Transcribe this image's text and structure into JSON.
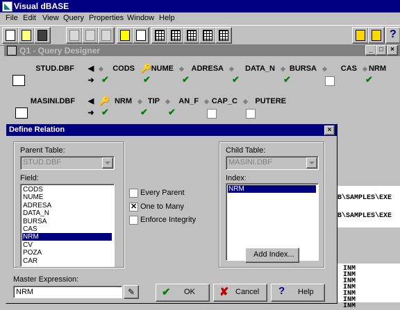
{
  "app": {
    "title": "Visual dBASE"
  },
  "menu": [
    "File",
    "Edit",
    "View",
    "Query",
    "Properties",
    "Window",
    "Help"
  ],
  "toolbar": {
    "buttons": [
      "new-icon",
      "open-icon",
      "save-icon",
      "cut-icon",
      "copy-icon",
      "paste-icon",
      "run-icon",
      "design-icon",
      "form-icon",
      "table-icon",
      "add-table-icon",
      "relation-icon",
      "expert-icon",
      "lamp-icon",
      "help-icon"
    ]
  },
  "query_designer": {
    "title": "Q1 - Query Designer",
    "tables": [
      {
        "name": "STUD.DBF",
        "fields": [
          "CODS",
          "NUME",
          "ADRESA",
          "DATA_N",
          "BURSA",
          "CAS",
          "NRM"
        ],
        "checked": [
          true,
          true,
          true,
          true,
          true,
          false,
          true
        ]
      },
      {
        "name": "MASINI.DBF",
        "fields": [
          "NRM",
          "TIP",
          "AN_F",
          "CAP_C",
          "PUTERE"
        ],
        "checked": [
          true,
          true,
          true,
          false,
          false
        ]
      }
    ]
  },
  "dialog": {
    "title": "Define Relation",
    "parent_table_label": "Parent Table:",
    "parent_table_value": "STUD.DBF",
    "field_label": "Field:",
    "fields": [
      "CODS",
      "NUME",
      "ADRESA",
      "DATA_N",
      "BURSA",
      "CAS",
      "NRM",
      "CV",
      "POZA",
      "CAR"
    ],
    "selected_field": "NRM",
    "options": [
      {
        "label": "Every Parent",
        "checked": false
      },
      {
        "label": "One to Many",
        "checked": true
      },
      {
        "label": "Enforce Integrity",
        "checked": false
      }
    ],
    "child_table_label": "Child Table:",
    "child_table_value": "MASINI.DBF",
    "index_label": "Index:",
    "indexes": [
      "NRM"
    ],
    "add_index_label": "Add Index...",
    "master_expression_label": "Master Expression:",
    "master_expression_value": "NRM",
    "ok_label": "OK",
    "cancel_label": "Cancel",
    "help_label": "Help"
  },
  "background_text": {
    "paths": [
      "B\\SAMPLES\\EXE",
      "B\\SAMPLES\\EXE"
    ],
    "inm_lines": [
      "INM",
      "INM",
      "INM",
      "INM",
      "INM",
      "INM",
      "INM"
    ]
  }
}
